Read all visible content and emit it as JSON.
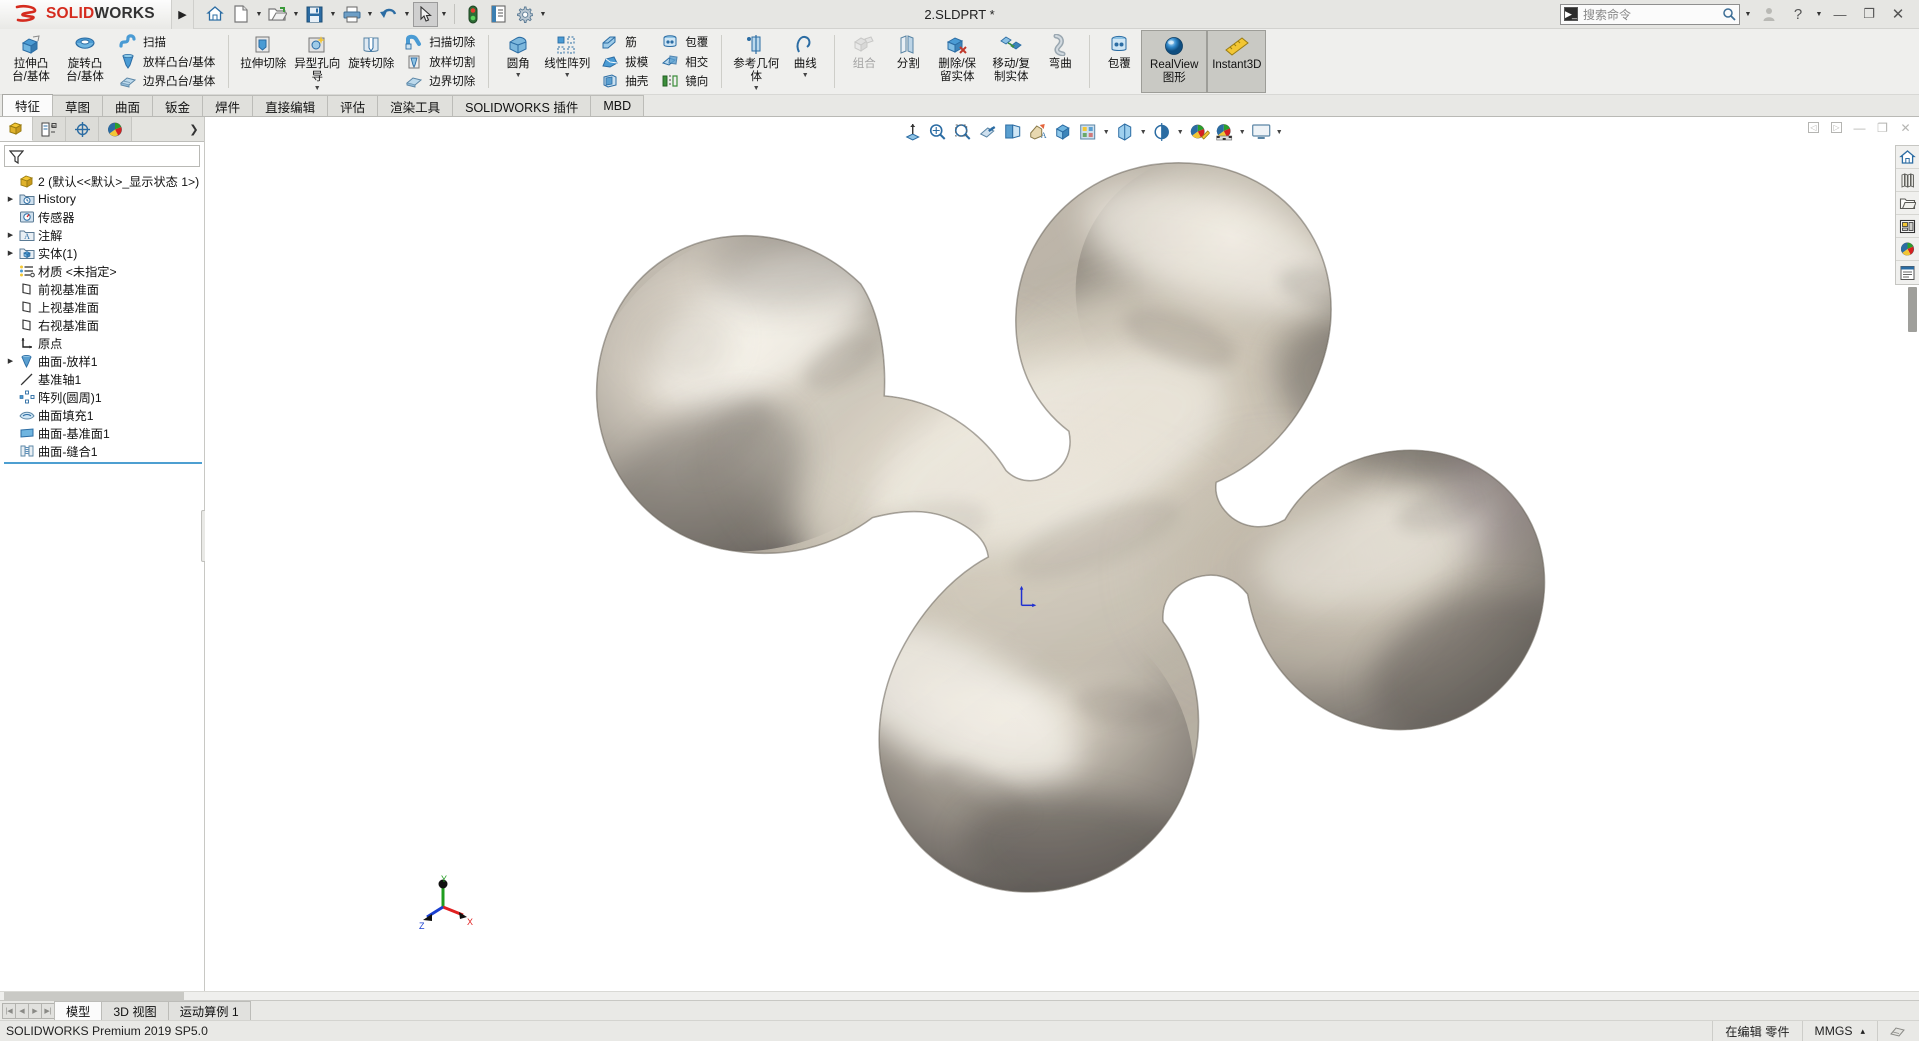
{
  "app": {
    "brand_mark": "3DS",
    "brand_name_red": "SOLID",
    "brand_name_dark": "WORKS",
    "document_title": "2.SLDPRT *",
    "version_status": "SOLIDWORKS Premium 2019 SP5.0"
  },
  "quick_access": [
    {
      "name": "home-icon",
      "glyph": "home"
    },
    {
      "name": "new-document-icon",
      "glyph": "newdoc"
    },
    {
      "name": "open-icon",
      "glyph": "open"
    },
    {
      "name": "save-icon",
      "glyph": "save"
    },
    {
      "name": "print-icon",
      "glyph": "print"
    },
    {
      "name": "undo-icon",
      "glyph": "undo"
    },
    {
      "name": "select-icon",
      "glyph": "cursor"
    },
    {
      "name": "rebuild-icon",
      "glyph": "traffic"
    },
    {
      "name": "file-properties-icon",
      "glyph": "props"
    },
    {
      "name": "options-icon",
      "glyph": "gear"
    }
  ],
  "search": {
    "placeholder": "搜索命令",
    "icon": "search-icon"
  },
  "window_buttons": {
    "user": "user-icon",
    "help": "?",
    "help_caret": "▾",
    "minimize": "—",
    "restore": "❐",
    "close": "✕"
  },
  "ribbon": {
    "groups": [
      {
        "name": "features-create",
        "big_buttons": [
          {
            "label": "拉伸凸台/基体",
            "icon": "extrude-boss-icon"
          },
          {
            "label": "旋转凸台/基体",
            "icon": "revolve-boss-icon"
          }
        ],
        "stack": [
          {
            "label": "扫描",
            "icon": "sweep-icon"
          },
          {
            "label": "放样凸台/基体",
            "icon": "loft-boss-icon"
          },
          {
            "label": "边界凸台/基体",
            "icon": "boundary-boss-icon"
          }
        ]
      },
      {
        "name": "features-cut",
        "big_buttons": [
          {
            "label": "拉伸切除",
            "icon": "extruded-cut-icon"
          },
          {
            "label": "异型孔向导",
            "icon": "hole-wizard-icon",
            "has_dropdown": true
          },
          {
            "label": "旋转切除",
            "icon": "revolved-cut-icon"
          }
        ],
        "stack": [
          {
            "label": "扫描切除",
            "icon": "swept-cut-icon"
          },
          {
            "label": "放样切割",
            "icon": "lofted-cut-icon"
          },
          {
            "label": "边界切除",
            "icon": "boundary-cut-icon"
          }
        ]
      },
      {
        "name": "features-modify",
        "big_buttons": [
          {
            "label": "圆角",
            "icon": "fillet-icon",
            "has_dropdown": true
          },
          {
            "label": "线性阵列",
            "icon": "linear-pattern-icon",
            "has_dropdown": true
          }
        ],
        "stack_a": [
          {
            "label": "筋",
            "icon": "rib-icon"
          },
          {
            "label": "拔模",
            "icon": "draft-icon"
          },
          {
            "label": "抽壳",
            "icon": "shell-icon"
          }
        ],
        "stack_b": [
          {
            "label": "包覆",
            "icon": "wrap-icon"
          },
          {
            "label": "相交",
            "icon": "intersect-icon"
          },
          {
            "label": "镜向",
            "icon": "mirror-icon"
          }
        ]
      },
      {
        "name": "reference-geometry",
        "big_buttons": [
          {
            "label": "参考几何体",
            "icon": "reference-geometry-icon",
            "has_dropdown": true
          },
          {
            "label": "曲线",
            "icon": "curves-icon",
            "has_dropdown": true
          }
        ]
      },
      {
        "name": "bodies",
        "big_buttons": [
          {
            "label": "组合",
            "icon": "combine-icon",
            "disabled": true
          },
          {
            "label": "分割",
            "icon": "split-icon"
          },
          {
            "label": "删除/保留实体",
            "icon": "delete-keep-body-icon"
          },
          {
            "label": "移动/复制实体",
            "icon": "move-copy-body-icon"
          },
          {
            "label": "弯曲",
            "icon": "flex-icon"
          }
        ]
      },
      {
        "name": "display",
        "big_buttons": [
          {
            "label": "包覆",
            "icon": "wrap2-icon"
          },
          {
            "label": "RealView 图形",
            "icon": "realview-icon",
            "active": true
          },
          {
            "label": "Instant3D",
            "icon": "instant3d-icon",
            "active": true
          }
        ]
      }
    ]
  },
  "tabs": [
    {
      "label": "特征",
      "active": true
    },
    {
      "label": "草图",
      "active": false
    },
    {
      "label": "曲面",
      "active": false
    },
    {
      "label": "钣金",
      "active": false
    },
    {
      "label": "焊件",
      "active": false
    },
    {
      "label": "直接编辑",
      "active": false
    },
    {
      "label": "评估",
      "active": false
    },
    {
      "label": "渲染工具",
      "active": false
    },
    {
      "label": "SOLIDWORKS 插件",
      "active": false
    },
    {
      "label": "MBD",
      "active": false
    }
  ],
  "left_panel": {
    "tabs": [
      {
        "name": "feature-manager-tab",
        "icon": "feature-tree-icon",
        "active": true
      },
      {
        "name": "property-manager-tab",
        "icon": "property-manager-icon",
        "active": false
      },
      {
        "name": "configuration-manager-tab",
        "icon": "configuration-icon",
        "active": false
      },
      {
        "name": "display-manager-tab",
        "icon": "display-manager-icon",
        "active": false
      }
    ],
    "filter_icon": "filter-icon",
    "tree": [
      {
        "label": "2  (默认<<默认>_显示状态 1>)",
        "icon": "part-icon",
        "expandable": false,
        "level": 0,
        "root": true
      },
      {
        "label": "History",
        "icon": "history-icon",
        "expandable": true,
        "level": 1
      },
      {
        "label": "传感器",
        "icon": "sensors-icon",
        "expandable": false,
        "level": 1
      },
      {
        "label": "注解",
        "icon": "annotations-icon",
        "expandable": true,
        "level": 1
      },
      {
        "label": "实体(1)",
        "icon": "solid-bodies-icon",
        "expandable": true,
        "level": 1
      },
      {
        "label": "材质 <未指定>",
        "icon": "material-icon",
        "expandable": false,
        "level": 1
      },
      {
        "label": "前视基准面",
        "icon": "plane-icon",
        "expandable": false,
        "level": 1
      },
      {
        "label": "上视基准面",
        "icon": "plane-icon",
        "expandable": false,
        "level": 1
      },
      {
        "label": "右视基准面",
        "icon": "plane-icon",
        "expandable": false,
        "level": 1
      },
      {
        "label": "原点",
        "icon": "origin-icon",
        "expandable": false,
        "level": 1
      },
      {
        "label": "曲面-放样1",
        "icon": "surface-loft-icon",
        "expandable": true,
        "level": 1
      },
      {
        "label": "基准轴1",
        "icon": "axis-icon",
        "expandable": false,
        "level": 1
      },
      {
        "label": "阵列(圆周)1",
        "icon": "circular-pattern-icon",
        "expandable": false,
        "level": 1
      },
      {
        "label": "曲面填充1",
        "icon": "filled-surface-icon",
        "expandable": false,
        "level": 1
      },
      {
        "label": "曲面-基准面1",
        "icon": "planar-surface-icon",
        "expandable": false,
        "level": 1
      },
      {
        "label": "曲面-缝合1",
        "icon": "knit-surface-icon",
        "expandable": false,
        "level": 1
      }
    ]
  },
  "view_toolbar": [
    {
      "name": "zoom-to-fit-icon",
      "glyph": "fit"
    },
    {
      "name": "zoom-to-area-icon",
      "glyph": "zoomarea"
    },
    {
      "name": "previous-view-icon",
      "glyph": "prevview"
    },
    {
      "name": "section-view-icon",
      "glyph": "section"
    },
    {
      "name": "view-orientation-icon",
      "glyph": "orient"
    },
    {
      "name": "display-style-icon",
      "glyph": "displaystyle",
      "has_dropdown": true
    },
    {
      "name": "hide-show-items-icon",
      "glyph": "hideshow",
      "has_dropdown": true
    },
    {
      "name": "edit-appearance-icon",
      "glyph": "appearance",
      "has_dropdown": true
    },
    {
      "name": "apply-scene-icon",
      "glyph": "scene",
      "has_dropdown": true
    },
    {
      "name": "view-settings-icon",
      "glyph": "viewsettings",
      "has_dropdown": true
    }
  ],
  "graphics_window_buttons": [
    {
      "name": "pane-left-icon",
      "glyph": "◁"
    },
    {
      "name": "pane-right-icon",
      "glyph": "▷"
    },
    {
      "name": "minimize-view-icon",
      "glyph": "—"
    },
    {
      "name": "restore-view-icon",
      "glyph": "❐"
    },
    {
      "name": "close-view-icon",
      "glyph": "✕"
    }
  ],
  "right_rail": [
    {
      "name": "design-library-home-icon",
      "glyph": "home"
    },
    {
      "name": "design-library-icon",
      "glyph": "library"
    },
    {
      "name": "file-explorer-icon",
      "glyph": "folder"
    },
    {
      "name": "view-palette-icon",
      "glyph": "palette-layout"
    },
    {
      "name": "appearances-scenes-icon",
      "glyph": "appearance-ball"
    },
    {
      "name": "custom-properties-icon",
      "glyph": "properties"
    }
  ],
  "triad": {
    "x_label": "X",
    "y_label": "Y",
    "z_label": "Z",
    "x_color": "#e02020",
    "y_color": "#1f9d1f",
    "z_color": "#1a3fd0"
  },
  "bottom_tabs": [
    {
      "label": "模型",
      "active": true
    },
    {
      "label": "3D 视图",
      "active": false
    },
    {
      "label": "运动算例 1",
      "active": false
    }
  ],
  "status_bar": {
    "left": "SOLIDWORKS Premium 2019 SP5.0",
    "editing": "在编辑 零件",
    "units": "MMGS",
    "units_caret": "▴"
  },
  "model": {
    "description": "四叶形金属曲面实体 (four-lobed metallic surface body)",
    "accent_color": "#b7b0a4"
  }
}
